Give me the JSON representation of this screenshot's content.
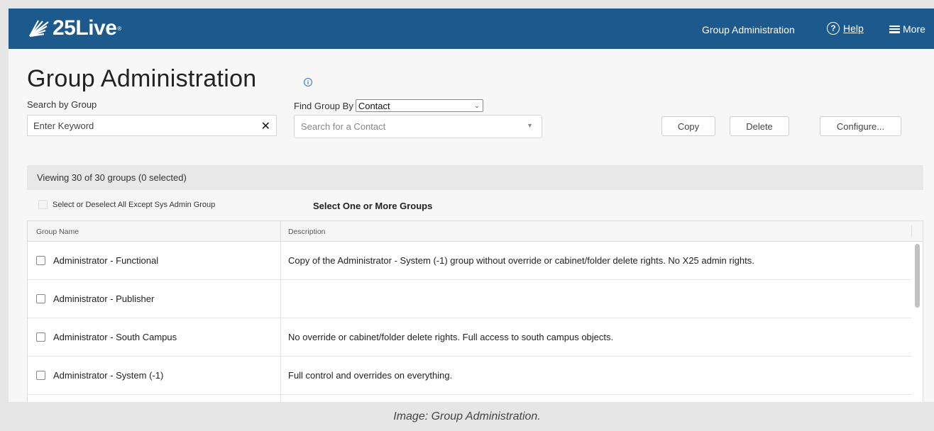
{
  "header": {
    "logo_text": "25Live",
    "logo_mark": "®",
    "nav_group": "Group Administration",
    "help_glyph": "?",
    "help_label": "Help",
    "more_label": "More"
  },
  "page": {
    "title": "Group Administration",
    "info_glyph": "i"
  },
  "search": {
    "label": "Search by Group",
    "placeholder": "Enter Keyword",
    "clear_glyph": "✕"
  },
  "find": {
    "label": "Find Group By",
    "selected": "Contact",
    "contact_placeholder": "Search for a Contact"
  },
  "buttons": {
    "copy": "Copy",
    "delete": "Delete",
    "configure": "Configure..."
  },
  "status": {
    "viewing": "Viewing 30 of 30 groups (0 selected)"
  },
  "selection": {
    "select_all_label": "Select or Deselect All Except Sys Admin Group",
    "heading": "Select One or More Groups"
  },
  "table": {
    "columns": [
      "Group Name",
      "Description"
    ],
    "rows": [
      {
        "name": "Administrator - Functional",
        "description": "Copy of the Administrator - System (-1) group without override or cabinet/folder delete rights. No X25 admin rights."
      },
      {
        "name": "Administrator - Publisher",
        "description": ""
      },
      {
        "name": "Administrator - South Campus",
        "description": "No override or cabinet/folder delete rights. Full access to south campus objects."
      },
      {
        "name": "Administrator - System (-1)",
        "description": "Full control and overrides on everything."
      }
    ]
  },
  "caption": "Image: Group Administration.",
  "colors": {
    "topbar": "#1c5a8e",
    "info_accent": "#2b74c8"
  },
  "icons": [
    "logo-mark-icon",
    "help-circle-icon",
    "hamburger-icon",
    "info-icon",
    "clear-icon",
    "chevron-down-icon",
    "caret-down-icon"
  ]
}
